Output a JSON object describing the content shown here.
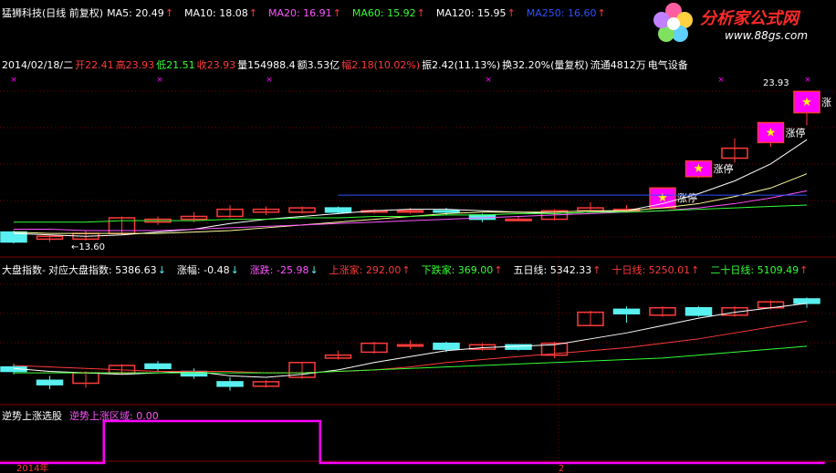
{
  "colors": {
    "bg": "#000000",
    "grid": "#7a0000",
    "up": "#ff3a3a",
    "down": "#58f0f0",
    "limit_fill": "#ff00ff",
    "white": "#ffffff",
    "yellow": "#ffff00",
    "magenta": "#ff00ff",
    "green": "#00ff00",
    "blue": "#3050ff"
  },
  "main_header": {
    "title": "猛狮科技(日线 前复权)",
    "ma": [
      {
        "label": "MA5: 20.49",
        "color": "#ffffff"
      },
      {
        "label": "MA10: 18.08",
        "color": "#ffffff"
      },
      {
        "label": "MA20: 16.91",
        "color": "#ff55ff"
      },
      {
        "label": "MA60: 15.92",
        "color": "#33ff33"
      },
      {
        "label": "MA120: 15.95",
        "color": "#ffffff"
      },
      {
        "label": "MA250: 16.60",
        "color": "#3050ff"
      }
    ]
  },
  "bar_info": {
    "date": "2014/02/18/二",
    "open": "开22.41",
    "high": "高23.93",
    "low": "低21.51",
    "close": "收23.93",
    "volume": "量154988.4",
    "amount": "额3.53亿",
    "change": "幅2.18(10.02%)",
    "amplitude": "振2.42(11.13%)",
    "turnover": "换32.20%(量复权)",
    "float": "流通4812万",
    "sector": "电气设备"
  },
  "price_labels": {
    "high": "23.93",
    "low": "13.60"
  },
  "limit_up_label": "涨停",
  "limit_up_label_cut": "涨",
  "star": "★",
  "index_header": {
    "title": "大盘指数-",
    "items": [
      {
        "label": "对应大盘指数: 5386.63",
        "color": "#ffffff",
        "arrow": "↓",
        "arrow_color": "#58f0f0"
      },
      {
        "label": "涨幅: -0.48",
        "color": "#ffffff",
        "arrow": "↓",
        "arrow_color": "#58f0f0"
      },
      {
        "label": "涨跌: -25.98",
        "color": "#ff55ff",
        "arrow": "↓",
        "arrow_color": "#58f0f0"
      },
      {
        "label": "上涨家: 292.00",
        "color": "#ff3a3a",
        "arrow": "↑",
        "arrow_color": "#ff3a3a"
      },
      {
        "label": "下跌家: 369.00",
        "color": "#33ff33",
        "arrow": "↑",
        "arrow_color": "#ff3a3a"
      },
      {
        "label": "五日线: 5342.33",
        "color": "#ffffff",
        "arrow": "↑",
        "arrow_color": "#ff3a3a"
      },
      {
        "label": "十日线: 5250.01",
        "color": "#ff3a3a",
        "arrow": "↑",
        "arrow_color": "#ff3a3a"
      },
      {
        "label": "二十日线: 5109.49",
        "color": "#33ff33",
        "arrow": "↑",
        "arrow_color": "#ff3a3a"
      }
    ]
  },
  "indicator_header": {
    "title": "逆势上涨选股",
    "value_label": "逆势上涨区域: 0.00"
  },
  "x_axis": {
    "labels": [
      "2014年",
      "2"
    ]
  },
  "logo": {
    "brand": "分析家公式网",
    "url": "www.88gs.com"
  },
  "chart_data": {
    "type": "candlestick",
    "main": {
      "ylim": [
        12.5,
        25.2
      ],
      "candles": [
        {
          "o": 14.0,
          "c": 13.3,
          "h": 14.1,
          "l": 13.2
        },
        {
          "o": 13.5,
          "c": 13.7,
          "h": 13.8,
          "l": 13.3
        },
        {
          "o": 13.5,
          "c": 13.9,
          "h": 14.1,
          "l": 13.4
        },
        {
          "o": 13.9,
          "c": 15.0,
          "h": 15.1,
          "l": 13.8
        },
        {
          "o": 14.7,
          "c": 14.9,
          "h": 15.1,
          "l": 14.5
        },
        {
          "o": 14.9,
          "c": 15.1,
          "h": 15.4,
          "l": 14.7
        },
        {
          "o": 15.1,
          "c": 15.6,
          "h": 15.9,
          "l": 15.0
        },
        {
          "o": 15.4,
          "c": 15.6,
          "h": 15.8,
          "l": 15.2
        },
        {
          "o": 15.4,
          "c": 15.7,
          "h": 15.8,
          "l": 15.3
        },
        {
          "o": 15.7,
          "c": 15.4,
          "h": 15.8,
          "l": 15.3
        },
        {
          "o": 15.4,
          "c": 15.5,
          "h": 15.6,
          "l": 15.3
        },
        {
          "o": 15.5,
          "c": 15.5,
          "h": 15.7,
          "l": 15.3
        },
        {
          "o": 15.5,
          "c": 15.4,
          "h": 15.7,
          "l": 15.2
        },
        {
          "o": 15.2,
          "c": 14.9,
          "h": 15.3,
          "l": 14.7
        },
        {
          "o": 14.9,
          "c": 14.9,
          "h": 15.1,
          "l": 14.8
        },
        {
          "o": 14.9,
          "c": 15.5,
          "h": 15.6,
          "l": 14.8
        },
        {
          "o": 15.5,
          "c": 15.7,
          "h": 16.1,
          "l": 15.5
        },
        {
          "o": 15.6,
          "c": 15.6,
          "h": 15.9,
          "l": 15.4
        },
        {
          "o": 15.7,
          "c": 17.1,
          "h": 17.1,
          "l": 15.7,
          "limit": true
        },
        {
          "o": 17.9,
          "c": 19.0,
          "h": 19.0,
          "l": 17.8,
          "limit": true
        },
        {
          "o": 19.2,
          "c": 19.9,
          "h": 20.6,
          "l": 18.9
        },
        {
          "o": 20.3,
          "c": 21.7,
          "h": 21.7,
          "l": 20.0,
          "limit": true
        },
        {
          "o": 22.4,
          "c": 23.9,
          "h": 23.9,
          "l": 21.5,
          "limit": true
        }
      ],
      "ma_lines": [
        {
          "name": "MA5",
          "color": "#ffffff",
          "values": [
            13.9,
            13.8,
            13.7,
            13.8,
            14.0,
            14.2,
            14.6,
            14.9,
            15.1,
            15.3,
            15.5,
            15.6,
            15.6,
            15.5,
            15.4,
            15.3,
            15.4,
            15.5,
            16.0,
            16.7,
            17.6,
            18.8,
            20.5
          ]
        },
        {
          "name": "MA10",
          "color": "#ffff99",
          "values": [
            14.0,
            13.9,
            13.9,
            13.9,
            13.9,
            14.0,
            14.1,
            14.3,
            14.5,
            14.7,
            14.9,
            15.1,
            15.3,
            15.4,
            15.4,
            15.4,
            15.5,
            15.5,
            15.7,
            16.0,
            16.5,
            17.1,
            18.1
          ]
        },
        {
          "name": "MA20",
          "color": "#ff55ff",
          "values": [
            14.2,
            14.2,
            14.1,
            14.1,
            14.1,
            14.2,
            14.3,
            14.4,
            14.5,
            14.6,
            14.7,
            14.8,
            14.9,
            15.0,
            15.1,
            15.2,
            15.3,
            15.4,
            15.5,
            15.7,
            16.0,
            16.4,
            16.9
          ]
        },
        {
          "name": "MA60",
          "color": "#33ff33",
          "values": [
            14.7,
            14.7,
            14.7,
            14.8,
            14.8,
            14.8,
            14.9,
            14.9,
            15.0,
            15.0,
            15.1,
            15.1,
            15.2,
            15.2,
            15.3,
            15.3,
            15.4,
            15.4,
            15.5,
            15.6,
            15.7,
            15.8,
            15.9
          ]
        },
        {
          "name": "MA250",
          "color": "#3050ff",
          "values": [
            null,
            null,
            null,
            null,
            null,
            null,
            null,
            null,
            null,
            16.6,
            16.6,
            16.6,
            16.6,
            16.6,
            16.6,
            16.6,
            16.6,
            16.6,
            16.6,
            16.6,
            16.6,
            16.6,
            16.6
          ]
        }
      ]
    },
    "index": {
      "ylim": [
        4600,
        5450
      ],
      "candles": [
        {
          "o": 4830,
          "c": 4800,
          "h": 4850,
          "l": 4780
        },
        {
          "o": 4740,
          "c": 4710,
          "h": 4770,
          "l": 4680
        },
        {
          "o": 4720,
          "c": 4790,
          "h": 4800,
          "l": 4690
        },
        {
          "o": 4790,
          "c": 4840,
          "h": 4850,
          "l": 4780
        },
        {
          "o": 4850,
          "c": 4820,
          "h": 4870,
          "l": 4800
        },
        {
          "o": 4800,
          "c": 4770,
          "h": 4820,
          "l": 4750
        },
        {
          "o": 4730,
          "c": 4700,
          "h": 4760,
          "l": 4670
        },
        {
          "o": 4700,
          "c": 4730,
          "h": 4740,
          "l": 4690
        },
        {
          "o": 4760,
          "c": 4860,
          "h": 4860,
          "l": 4750
        },
        {
          "o": 4890,
          "c": 4910,
          "h": 4940,
          "l": 4880
        },
        {
          "o": 4930,
          "c": 4990,
          "h": 5000,
          "l": 4920
        },
        {
          "o": 4980,
          "c": 4980,
          "h": 5010,
          "l": 4950
        },
        {
          "o": 4990,
          "c": 4950,
          "h": 5000,
          "l": 4930
        },
        {
          "o": 4950,
          "c": 4980,
          "h": 4990,
          "l": 4940
        },
        {
          "o": 4980,
          "c": 4950,
          "h": 4980,
          "l": 4940
        },
        {
          "o": 4910,
          "c": 4990,
          "h": 5000,
          "l": 4890
        },
        {
          "o": 5110,
          "c": 5200,
          "h": 5210,
          "l": 5110
        },
        {
          "o": 5220,
          "c": 5190,
          "h": 5240,
          "l": 5130
        },
        {
          "o": 5180,
          "c": 5230,
          "h": 5240,
          "l": 5170
        },
        {
          "o": 5230,
          "c": 5180,
          "h": 5240,
          "l": 5170
        },
        {
          "o": 5180,
          "c": 5230,
          "h": 5240,
          "l": 5170
        },
        {
          "o": 5230,
          "c": 5270,
          "h": 5280,
          "l": 5220
        },
        {
          "o": 5290,
          "c": 5260,
          "h": 5300,
          "l": 5230
        }
      ],
      "ma_lines": [
        {
          "name": "五日线",
          "color": "#ffffff",
          "values": [
            4820,
            4800,
            4790,
            4780,
            4790,
            4800,
            4770,
            4760,
            4780,
            4810,
            4860,
            4900,
            4940,
            4960,
            4970,
            4980,
            5020,
            5060,
            5110,
            5160,
            5200,
            5230,
            5260
          ]
        },
        {
          "name": "十日线",
          "color": "#ff3a3a",
          "values": [
            4840,
            4830,
            4820,
            4810,
            4800,
            4800,
            4800,
            4790,
            4790,
            4800,
            4810,
            4830,
            4860,
            4880,
            4900,
            4920,
            4940,
            4960,
            4990,
            5020,
            5060,
            5100,
            5140
          ]
        },
        {
          "name": "二十日线",
          "color": "#33ff33",
          "values": [
            4790,
            4790,
            4790,
            4790,
            4790,
            4790,
            4790,
            4790,
            4790,
            4800,
            4810,
            4820,
            4830,
            4840,
            4850,
            4860,
            4870,
            4880,
            4890,
            4910,
            4930,
            4950,
            4970
          ]
        }
      ]
    },
    "indicator": {
      "ylim": [
        0,
        1
      ],
      "values": [
        0,
        0,
        0,
        1,
        1,
        1,
        1,
        1,
        1,
        0,
        0,
        0,
        0,
        0,
        0,
        0,
        0,
        0,
        0,
        0,
        0,
        0,
        0
      ]
    }
  }
}
